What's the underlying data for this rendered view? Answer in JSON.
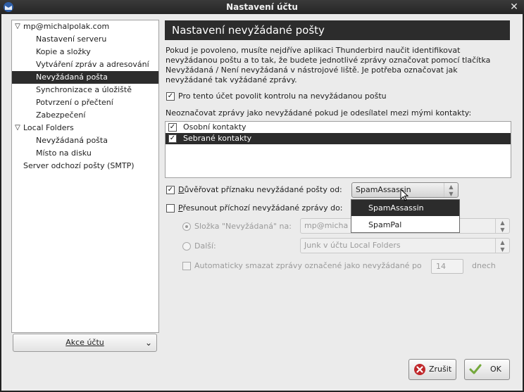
{
  "window": {
    "title": "Nastavení účtu"
  },
  "tree": [
    {
      "label": "mp@michalpolak.com",
      "level": 0,
      "expanded": true
    },
    {
      "label": "Nastavení serveru",
      "level": 1
    },
    {
      "label": "Kopie a složky",
      "level": 1
    },
    {
      "label": "Vytváření zpráv a adresování",
      "level": 1
    },
    {
      "label": "Nevyžádaná pošta",
      "level": 1,
      "selected": true
    },
    {
      "label": "Synchronizace a úložiště",
      "level": 1
    },
    {
      "label": "Potvrzení o přečtení",
      "level": 1
    },
    {
      "label": "Zabezpečení",
      "level": 1
    },
    {
      "label": "Local Folders",
      "level": 0,
      "expanded": true
    },
    {
      "label": "Nevyžádaná pošta",
      "level": 1
    },
    {
      "label": "Místo na disku",
      "level": 1
    },
    {
      "label": "Server odchozí pošty (SMTP)",
      "level": 0
    }
  ],
  "account_actions": {
    "label": "Akce účtu"
  },
  "panel": {
    "title": "Nastavení nevyžádané pošty",
    "description": "Pokud je povoleno, musíte nejdříve aplikaci Thunderbird naučit identifikovat nevyžádanou poštu a to tak, že budete jednotlivé zprávy označovat pomocí tlačítka Nevyžádaná / Není nevyžádaná v nástrojové liště. Je potřeba označovat jak nevyžádané tak vyžádané zprávy.",
    "enable_check": {
      "label": "Pro tento účet povolit kontrolu na nevyžádanou poštu",
      "checked": true
    },
    "whitelist_label": "Neoznačovat zprávy jako nevyžádané pokud je odesílatel mezi mými kontakty:",
    "whitelist": [
      {
        "label": "Osobní kontakty",
        "checked": true
      },
      {
        "label": "Sebrané kontakty",
        "checked": true,
        "selected": true
      }
    ],
    "trust_check": {
      "label": "Důvěřovat příznaku nevyžádané pošty od:",
      "checked": true
    },
    "trust_select": {
      "value": "SpamAssassin",
      "options": [
        "SpamAssassin",
        "SpamPal"
      ],
      "highlighted": "SpamAssassin"
    },
    "move_check": {
      "label": "Přesunout příchozí nevyžádané zprávy do:",
      "checked": false
    },
    "folder_radio": {
      "label": "Složka \"Nevyžádaná\" na:",
      "checked": true,
      "value": "mp@micha"
    },
    "other_radio": {
      "label": "Další:",
      "checked": false,
      "value": "Junk v účtu Local Folders"
    },
    "auto_delete": {
      "label": "Automaticky smazat zprávy označené jako nevyžádané po",
      "value": "14",
      "unit": "dnech",
      "checked": false
    }
  },
  "buttons": {
    "cancel": "Zrušit",
    "ok": "OK"
  },
  "colors": {
    "selection": "#2c2c2c",
    "cancel_icon": "#c0282b",
    "ok_icon": "#74a83c"
  }
}
